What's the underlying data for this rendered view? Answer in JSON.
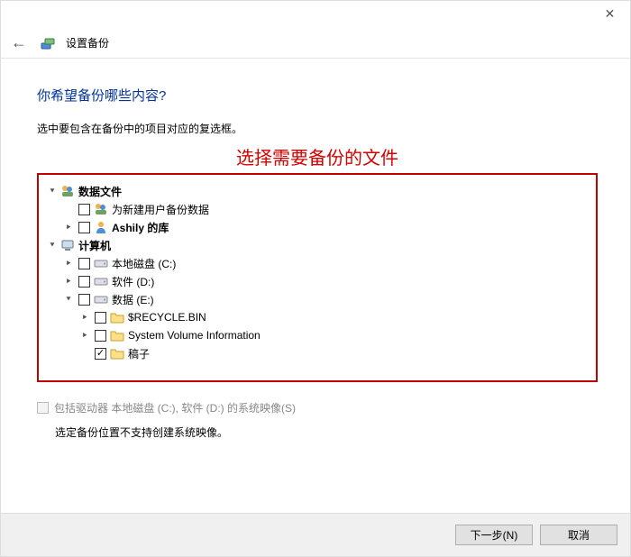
{
  "window": {
    "title": "设置备份",
    "close": "✕",
    "back": "←"
  },
  "question": "你希望备份哪些内容?",
  "instruction": "选中要包含在备份中的项目对应的复选框。",
  "annotation": "选择需要备份的文件",
  "tree": {
    "data_files": {
      "label": "数据文件"
    },
    "new_user": {
      "label": "为新建用户备份数据"
    },
    "ashily": {
      "label": "Ashily 的库"
    },
    "computer": {
      "label": "计算机"
    },
    "drive_c": {
      "label": "本地磁盘 (C:)"
    },
    "drive_d": {
      "label": "软件 (D:)"
    },
    "drive_e": {
      "label": "数据 (E:)"
    },
    "recycle": {
      "label": "$RECYCLE.BIN"
    },
    "svi": {
      "label": "System Volume Information"
    },
    "gaozi": {
      "label": "稿子"
    }
  },
  "include_image": {
    "label": "包括驱动器 本地磁盘 (C:), 软件 (D:) 的系统映像(S)"
  },
  "note": "选定备份位置不支持创建系统映像。",
  "buttons": {
    "next": "下一步(N)",
    "cancel": "取消"
  }
}
